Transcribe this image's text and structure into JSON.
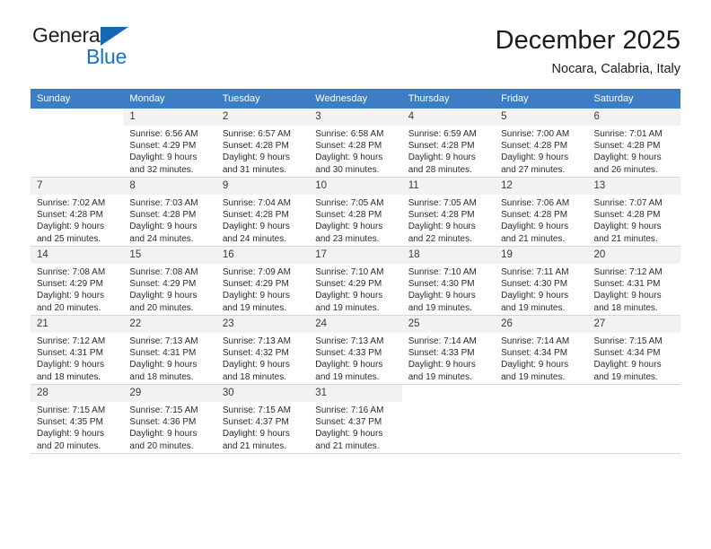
{
  "brand": {
    "name_top": "General",
    "name_bottom": "Blue",
    "accent_color": "#1a72bb"
  },
  "header": {
    "title": "December 2025",
    "subtitle": "Nocara, Calabria, Italy"
  },
  "calendar": {
    "header_bg": "#3c7dc4",
    "daynum_bg": "#f2f2f2",
    "weekday_headers": [
      "Sunday",
      "Monday",
      "Tuesday",
      "Wednesday",
      "Thursday",
      "Friday",
      "Saturday"
    ],
    "labels": {
      "sunrise_prefix": "Sunrise:",
      "sunset_prefix": "Sunset:",
      "daylight_prefix": "Daylight:"
    },
    "weeks": [
      [
        {
          "day": "",
          "empty": true
        },
        {
          "day": "1",
          "sunrise": "Sunrise: 6:56 AM",
          "sunset": "Sunset: 4:29 PM",
          "daylight1": "Daylight: 9 hours",
          "daylight2": "and 32 minutes."
        },
        {
          "day": "2",
          "sunrise": "Sunrise: 6:57 AM",
          "sunset": "Sunset: 4:28 PM",
          "daylight1": "Daylight: 9 hours",
          "daylight2": "and 31 minutes."
        },
        {
          "day": "3",
          "sunrise": "Sunrise: 6:58 AM",
          "sunset": "Sunset: 4:28 PM",
          "daylight1": "Daylight: 9 hours",
          "daylight2": "and 30 minutes."
        },
        {
          "day": "4",
          "sunrise": "Sunrise: 6:59 AM",
          "sunset": "Sunset: 4:28 PM",
          "daylight1": "Daylight: 9 hours",
          "daylight2": "and 28 minutes."
        },
        {
          "day": "5",
          "sunrise": "Sunrise: 7:00 AM",
          "sunset": "Sunset: 4:28 PM",
          "daylight1": "Daylight: 9 hours",
          "daylight2": "and 27 minutes."
        },
        {
          "day": "6",
          "sunrise": "Sunrise: 7:01 AM",
          "sunset": "Sunset: 4:28 PM",
          "daylight1": "Daylight: 9 hours",
          "daylight2": "and 26 minutes."
        }
      ],
      [
        {
          "day": "7",
          "sunrise": "Sunrise: 7:02 AM",
          "sunset": "Sunset: 4:28 PM",
          "daylight1": "Daylight: 9 hours",
          "daylight2": "and 25 minutes."
        },
        {
          "day": "8",
          "sunrise": "Sunrise: 7:03 AM",
          "sunset": "Sunset: 4:28 PM",
          "daylight1": "Daylight: 9 hours",
          "daylight2": "and 24 minutes."
        },
        {
          "day": "9",
          "sunrise": "Sunrise: 7:04 AM",
          "sunset": "Sunset: 4:28 PM",
          "daylight1": "Daylight: 9 hours",
          "daylight2": "and 24 minutes."
        },
        {
          "day": "10",
          "sunrise": "Sunrise: 7:05 AM",
          "sunset": "Sunset: 4:28 PM",
          "daylight1": "Daylight: 9 hours",
          "daylight2": "and 23 minutes."
        },
        {
          "day": "11",
          "sunrise": "Sunrise: 7:05 AM",
          "sunset": "Sunset: 4:28 PM",
          "daylight1": "Daylight: 9 hours",
          "daylight2": "and 22 minutes."
        },
        {
          "day": "12",
          "sunrise": "Sunrise: 7:06 AM",
          "sunset": "Sunset: 4:28 PM",
          "daylight1": "Daylight: 9 hours",
          "daylight2": "and 21 minutes."
        },
        {
          "day": "13",
          "sunrise": "Sunrise: 7:07 AM",
          "sunset": "Sunset: 4:28 PM",
          "daylight1": "Daylight: 9 hours",
          "daylight2": "and 21 minutes."
        }
      ],
      [
        {
          "day": "14",
          "sunrise": "Sunrise: 7:08 AM",
          "sunset": "Sunset: 4:29 PM",
          "daylight1": "Daylight: 9 hours",
          "daylight2": "and 20 minutes."
        },
        {
          "day": "15",
          "sunrise": "Sunrise: 7:08 AM",
          "sunset": "Sunset: 4:29 PM",
          "daylight1": "Daylight: 9 hours",
          "daylight2": "and 20 minutes."
        },
        {
          "day": "16",
          "sunrise": "Sunrise: 7:09 AM",
          "sunset": "Sunset: 4:29 PM",
          "daylight1": "Daylight: 9 hours",
          "daylight2": "and 19 minutes."
        },
        {
          "day": "17",
          "sunrise": "Sunrise: 7:10 AM",
          "sunset": "Sunset: 4:29 PM",
          "daylight1": "Daylight: 9 hours",
          "daylight2": "and 19 minutes."
        },
        {
          "day": "18",
          "sunrise": "Sunrise: 7:10 AM",
          "sunset": "Sunset: 4:30 PM",
          "daylight1": "Daylight: 9 hours",
          "daylight2": "and 19 minutes."
        },
        {
          "day": "19",
          "sunrise": "Sunrise: 7:11 AM",
          "sunset": "Sunset: 4:30 PM",
          "daylight1": "Daylight: 9 hours",
          "daylight2": "and 19 minutes."
        },
        {
          "day": "20",
          "sunrise": "Sunrise: 7:12 AM",
          "sunset": "Sunset: 4:31 PM",
          "daylight1": "Daylight: 9 hours",
          "daylight2": "and 18 minutes."
        }
      ],
      [
        {
          "day": "21",
          "sunrise": "Sunrise: 7:12 AM",
          "sunset": "Sunset: 4:31 PM",
          "daylight1": "Daylight: 9 hours",
          "daylight2": "and 18 minutes."
        },
        {
          "day": "22",
          "sunrise": "Sunrise: 7:13 AM",
          "sunset": "Sunset: 4:31 PM",
          "daylight1": "Daylight: 9 hours",
          "daylight2": "and 18 minutes."
        },
        {
          "day": "23",
          "sunrise": "Sunrise: 7:13 AM",
          "sunset": "Sunset: 4:32 PM",
          "daylight1": "Daylight: 9 hours",
          "daylight2": "and 18 minutes."
        },
        {
          "day": "24",
          "sunrise": "Sunrise: 7:13 AM",
          "sunset": "Sunset: 4:33 PM",
          "daylight1": "Daylight: 9 hours",
          "daylight2": "and 19 minutes."
        },
        {
          "day": "25",
          "sunrise": "Sunrise: 7:14 AM",
          "sunset": "Sunset: 4:33 PM",
          "daylight1": "Daylight: 9 hours",
          "daylight2": "and 19 minutes."
        },
        {
          "day": "26",
          "sunrise": "Sunrise: 7:14 AM",
          "sunset": "Sunset: 4:34 PM",
          "daylight1": "Daylight: 9 hours",
          "daylight2": "and 19 minutes."
        },
        {
          "day": "27",
          "sunrise": "Sunrise: 7:15 AM",
          "sunset": "Sunset: 4:34 PM",
          "daylight1": "Daylight: 9 hours",
          "daylight2": "and 19 minutes."
        }
      ],
      [
        {
          "day": "28",
          "sunrise": "Sunrise: 7:15 AM",
          "sunset": "Sunset: 4:35 PM",
          "daylight1": "Daylight: 9 hours",
          "daylight2": "and 20 minutes."
        },
        {
          "day": "29",
          "sunrise": "Sunrise: 7:15 AM",
          "sunset": "Sunset: 4:36 PM",
          "daylight1": "Daylight: 9 hours",
          "daylight2": "and 20 minutes."
        },
        {
          "day": "30",
          "sunrise": "Sunrise: 7:15 AM",
          "sunset": "Sunset: 4:37 PM",
          "daylight1": "Daylight: 9 hours",
          "daylight2": "and 21 minutes."
        },
        {
          "day": "31",
          "sunrise": "Sunrise: 7:16 AM",
          "sunset": "Sunset: 4:37 PM",
          "daylight1": "Daylight: 9 hours",
          "daylight2": "and 21 minutes."
        },
        {
          "day": "",
          "empty": true
        },
        {
          "day": "",
          "empty": true
        },
        {
          "day": "",
          "empty": true
        }
      ]
    ]
  }
}
